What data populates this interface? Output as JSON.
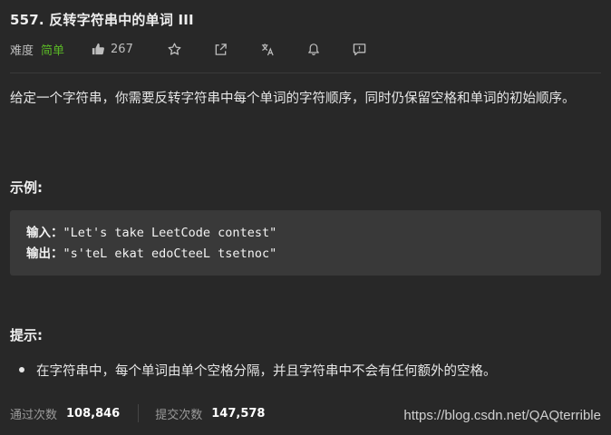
{
  "problem": {
    "title": "557. 反转字符串中的单词 III",
    "difficulty_label": "难度",
    "difficulty": "简单",
    "likes": "267"
  },
  "icons": [
    "thumb-up-icon",
    "star-icon",
    "share-icon",
    "translate-icon",
    "bell-icon",
    "feedback-icon"
  ],
  "description": "给定一个字符串，你需要反转字符串中每个单词的字符顺序，同时仍保留空格和单词的初始顺序。",
  "example": {
    "heading": "示例:",
    "input_label": "输入：",
    "input_value": "\"Let's take LeetCode contest\"",
    "output_label": "输出：",
    "output_value": "\"s'teL ekat edoCteeL tsetnoc\""
  },
  "hints": {
    "heading": "提示:",
    "items": [
      "在字符串中，每个单词由单个空格分隔，并且字符串中不会有任何额外的空格。"
    ]
  },
  "stats": {
    "accepted_label": "通过次数",
    "accepted": "108,846",
    "submissions_label": "提交次数",
    "submissions": "147,578"
  },
  "watermark": "https://blog.csdn.net/QAQterrible",
  "colors": {
    "background": "#282828",
    "difficulty_easy": "#5ab726",
    "code_bg": "#393939"
  }
}
